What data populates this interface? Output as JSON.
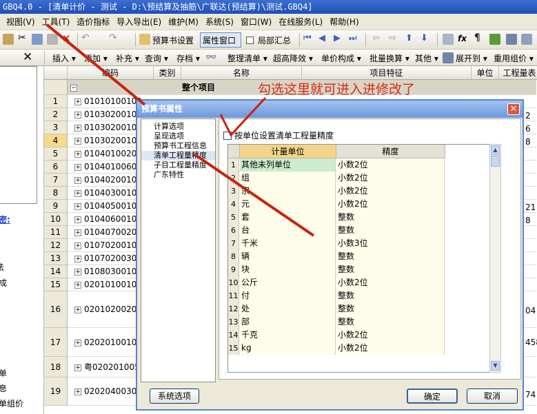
{
  "window": {
    "title": "GBQ4.0 - [清单计价 - 测试 - D:\\预结算及抽筋\\广联达(预结算)\\测试.GBQ4]"
  },
  "menu": [
    "视图(V)",
    "工具(T)",
    "造价指标",
    "导入导出(E)",
    "维护(M)",
    "系统(S)",
    "窗口(W)",
    "在线服务(L)",
    "帮助(H)"
  ],
  "toolbar1": {
    "budget_settings": "预算书设置",
    "property_window": "属性窗口",
    "local_summary": "局部汇总"
  },
  "toolbar2": {
    "items": [
      "插入",
      "添加",
      "补充",
      "查询",
      "存档",
      "整理清单",
      "超高降效",
      "单价构成",
      "批量换算",
      "其他",
      "展开到",
      "重用组价"
    ]
  },
  "grid": {
    "columns": {
      "code": "编码",
      "category": "类别",
      "name": "名称",
      "features": "项目特征",
      "unit": "单位",
      "quantity": "工程量表"
    },
    "group_label": "整个项目",
    "rows": [
      {
        "no": "1",
        "code": "01010100100"
      },
      {
        "no": "2",
        "code": "01030200100"
      },
      {
        "no": "3",
        "code": "01030200100"
      },
      {
        "no": "4",
        "code": "01030200100"
      },
      {
        "no": "5",
        "code": "01040100200"
      },
      {
        "no": "6",
        "code": "01040100600"
      },
      {
        "no": "7",
        "code": "01040200100"
      },
      {
        "no": "8",
        "code": "01040300100"
      },
      {
        "no": "9",
        "code": "01040500100"
      },
      {
        "no": "10",
        "code": "01040600100"
      },
      {
        "no": "11",
        "code": "01040700200"
      },
      {
        "no": "12",
        "code": "01070200100"
      },
      {
        "no": "13",
        "code": "01070200300"
      },
      {
        "no": "14",
        "code": "01080300100"
      },
      {
        "no": "15",
        "code": "02010100100"
      },
      {
        "no": "16",
        "code": "02010200200"
      },
      {
        "no": "17",
        "code": "02020100100"
      },
      {
        "no": "18",
        "code": "粤0202010050"
      },
      {
        "no": "19",
        "code": "02020400300"
      }
    ],
    "right_values": [
      "2",
      "6",
      "8",
      "21",
      "8",
      "04",
      "458",
      "74"
    ]
  },
  "left_panel": {
    "labels": [
      "密:",
      "法",
      "成",
      "单",
      "息",
      "单组价"
    ]
  },
  "dialog": {
    "title": "预算书属性",
    "nav": [
      "计算选项",
      "呈现选项",
      "预算书工程信息",
      "清单工程量精度",
      "子目工程量精度",
      "广东特性"
    ],
    "checkbox_label": "按单位设置清单工程量精度",
    "table_headers": {
      "unit": "计量单位",
      "precision": "精度"
    },
    "rows": [
      {
        "no": "1",
        "unit": "其他未列单位",
        "precision": "小数2位"
      },
      {
        "no": "2",
        "unit": "组",
        "precision": "小数2位"
      },
      {
        "no": "3",
        "unit": "宗",
        "precision": "小数2位"
      },
      {
        "no": "4",
        "unit": "元",
        "precision": "小数2位"
      },
      {
        "no": "5",
        "unit": "套",
        "precision": "整数"
      },
      {
        "no": "6",
        "unit": "台",
        "precision": "整数"
      },
      {
        "no": "7",
        "unit": "千米",
        "precision": "小数3位"
      },
      {
        "no": "8",
        "unit": "辆",
        "precision": "整数"
      },
      {
        "no": "9",
        "unit": "块",
        "precision": "整数"
      },
      {
        "no": "10",
        "unit": "公斤",
        "precision": "小数2位"
      },
      {
        "no": "11",
        "unit": "付",
        "precision": "整数"
      },
      {
        "no": "12",
        "unit": "处",
        "precision": "整数"
      },
      {
        "no": "13",
        "unit": "部",
        "precision": "整数"
      },
      {
        "no": "14",
        "unit": "千克",
        "precision": "小数2位"
      },
      {
        "no": "15",
        "unit": "kg",
        "precision": "小数2位"
      }
    ],
    "buttons": {
      "system_options": "系统选项",
      "ok": "确定",
      "cancel": "取消"
    }
  },
  "annotation": "勾选这里就可进入进修改了",
  "colors": {
    "title_bar": "#1d4fb8",
    "dialog_border": "#5585d7",
    "annotation": "#d82a10",
    "highlight_row": "#cdeccd"
  }
}
